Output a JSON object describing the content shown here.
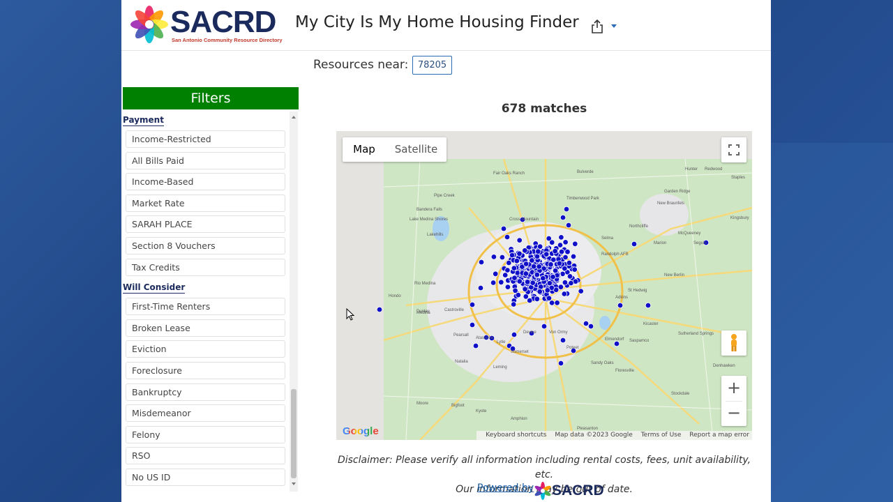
{
  "header": {
    "logo_text": "SACRD",
    "logo_subtitle": "San Antonio Community Resource Directory",
    "app_title": "My City Is My Home Housing Finder"
  },
  "search": {
    "label": "Resources near:",
    "zip": "78205"
  },
  "filters": {
    "title": "Filters",
    "sections": [
      {
        "label": "Payment",
        "items": [
          "Income-Restricted",
          "All Bills Paid",
          "Income-Based",
          "Market Rate",
          "SARAH PLACE",
          "Section 8 Vouchers",
          "Tax Credits"
        ]
      },
      {
        "label": "Will Consider",
        "items": [
          "First-Time Renters",
          "Broken Lease",
          "Eviction",
          "Foreclosure",
          "Bankruptcy",
          "Misdemeanor",
          "Felony",
          "RSO",
          "No US ID"
        ]
      }
    ]
  },
  "results": {
    "matches": "678 matches"
  },
  "map": {
    "type_map": "Map",
    "type_satellite": "Satellite",
    "zoom_in": "+",
    "zoom_out": "−",
    "google": "Google",
    "attribution": {
      "shortcuts": "Keyboard shortcuts",
      "data": "Map data ©2023 Google",
      "terms": "Terms of Use",
      "report": "Report a map error"
    },
    "place_labels": [
      "Hunter",
      "Redwood",
      "Bulverde",
      "Staples",
      "Fair Oaks Ranch",
      "Timberwood Park",
      "Garden Ridge",
      "Pipe Creek",
      "Bandera Falls",
      "New Braunfels",
      "Kingsbury",
      "Lake Medina Shores",
      "Cross Mountain",
      "Northcliffe",
      "Lakehills",
      "Selma",
      "Marion",
      "McQueeney",
      "Seguin",
      "Randolph AFB",
      "Rio Medina",
      "St Hedwig",
      "New Berlin",
      "Castroville",
      "Dunlay",
      "Hondo",
      "Adkins",
      "Von Ormy",
      "Kicaster",
      "Sutherland Springs",
      "Atascosa",
      "Elmendorf",
      "Pearsall",
      "Lytle",
      "Somerset",
      "Natalia",
      "Leming",
      "Sandy Oaks",
      "Devine",
      "Poteet",
      "Floresville",
      "Moore",
      "Bigfoot",
      "Pleasanton",
      "Amphion",
      "Kyote",
      "Stockdale",
      "Denhawken",
      "Saspamco",
      "Medina"
    ],
    "marker_color": "#1010c8"
  },
  "footer": {
    "disclaimer_line1": "Disclaimer: Please verify all information including rental costs, fees, unit availability, etc.",
    "disclaimer_line2": "Our information may be out of date.",
    "powered_by": "Powered by"
  },
  "colors": {
    "filters_header": "#008000",
    "brand_navy": "#1b2a5c",
    "link": "#1a5fa8"
  }
}
